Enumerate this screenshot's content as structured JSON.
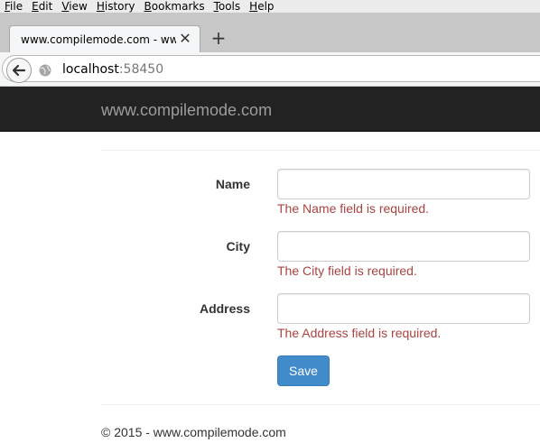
{
  "browser": {
    "menu": [
      {
        "label": "File",
        "accel": "F",
        "rest": "ile"
      },
      {
        "label": "Edit",
        "accel": "E",
        "rest": "dit"
      },
      {
        "label": "View",
        "accel": "V",
        "rest": "iew"
      },
      {
        "label": "History",
        "accel": "H",
        "rest": "istory"
      },
      {
        "label": "Bookmarks",
        "accel": "B",
        "rest": "ookmarks"
      },
      {
        "label": "Tools",
        "accel": "T",
        "rest": "ools"
      },
      {
        "label": "Help",
        "accel": "H",
        "rest": "elp"
      }
    ],
    "tab_title": "www.compilemode.com - ww...",
    "tab_close_glyph": "✕",
    "new_tab_glyph": "+",
    "url_host": "localhost",
    "url_port": ":58450",
    "back_icon": "back-arrow-icon",
    "site_icon": "globe-icon"
  },
  "site": {
    "brand": "www.compilemode.com"
  },
  "form": {
    "fields": [
      {
        "label": "Name",
        "value": "",
        "error": "The Name field is required."
      },
      {
        "label": "City",
        "value": "",
        "error": "The City field is required."
      },
      {
        "label": "Address",
        "value": "",
        "error": "The Address field is required."
      }
    ],
    "save_label": "Save"
  },
  "footer": {
    "text": "© 2015 - www.compilemode.com"
  },
  "colors": {
    "navbar_bg": "#222222",
    "brand_text": "#9d9d9d",
    "error_text": "#a94442",
    "primary_button": "#428bca"
  }
}
